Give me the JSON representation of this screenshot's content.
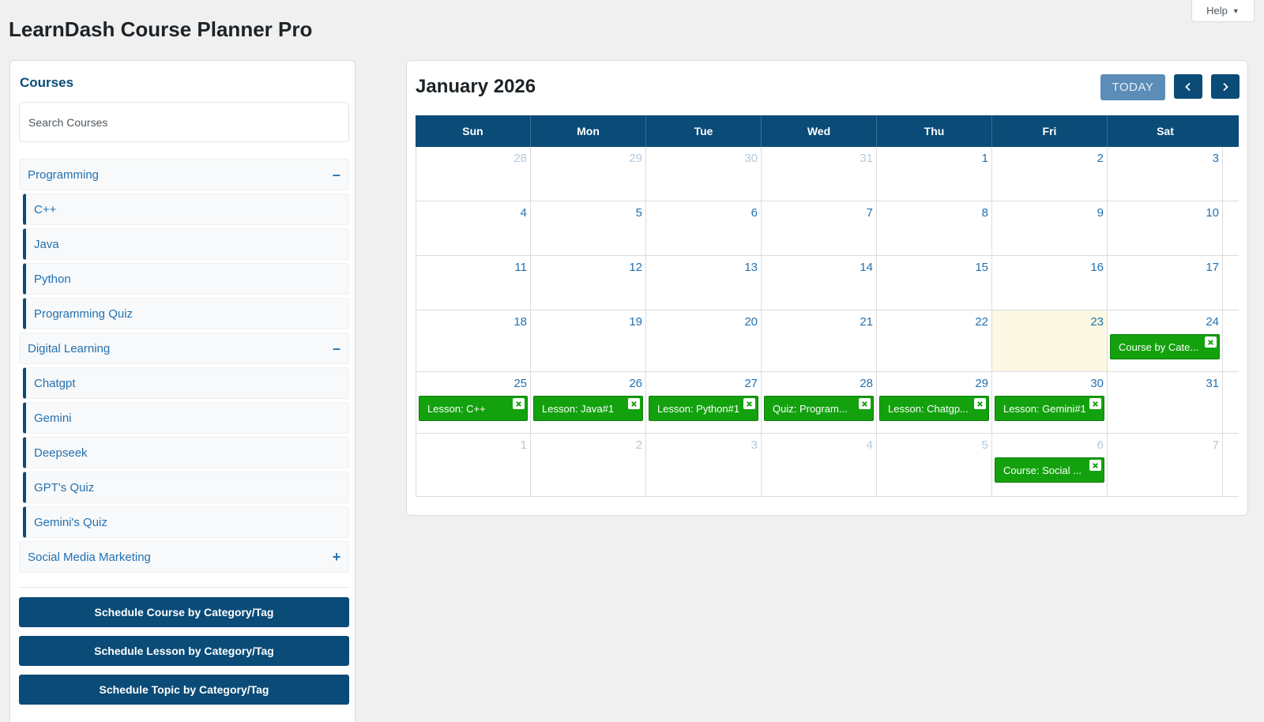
{
  "header": {
    "title": "LearnDash Course Planner Pro",
    "help_label": "Help"
  },
  "sidebar": {
    "title": "Courses",
    "search_placeholder": "Search Courses",
    "categories": [
      {
        "label": "Programming",
        "toggle": "–",
        "items": [
          "C++",
          "Java",
          "Python",
          "Programming Quiz"
        ]
      },
      {
        "label": "Digital Learning",
        "toggle": "–",
        "items": [
          "Chatgpt",
          "Gemini",
          "Deepseek",
          "GPT's Quiz",
          "Gemini's Quiz"
        ]
      },
      {
        "label": "Social Media Marketing",
        "toggle": "+",
        "items": []
      }
    ],
    "buttons": [
      "Schedule Course by Category/Tag",
      "Schedule Lesson by Category/Tag",
      "Schedule Topic by Category/Tag"
    ]
  },
  "calendar": {
    "title": "January 2026",
    "today_label": "TODAY",
    "days_of_week": [
      "Sun",
      "Mon",
      "Tue",
      "Wed",
      "Thu",
      "Fri",
      "Sat"
    ],
    "weeks": [
      [
        {
          "n": "28",
          "o": true
        },
        {
          "n": "29",
          "o": true
        },
        {
          "n": "30",
          "o": true
        },
        {
          "n": "31",
          "o": true
        },
        {
          "n": "1"
        },
        {
          "n": "2"
        },
        {
          "n": "3"
        }
      ],
      [
        {
          "n": "4"
        },
        {
          "n": "5"
        },
        {
          "n": "6"
        },
        {
          "n": "7"
        },
        {
          "n": "8"
        },
        {
          "n": "9"
        },
        {
          "n": "10"
        }
      ],
      [
        {
          "n": "11"
        },
        {
          "n": "12"
        },
        {
          "n": "13"
        },
        {
          "n": "14"
        },
        {
          "n": "15"
        },
        {
          "n": "16"
        },
        {
          "n": "17"
        }
      ],
      [
        {
          "n": "18"
        },
        {
          "n": "19"
        },
        {
          "n": "20"
        },
        {
          "n": "21"
        },
        {
          "n": "22"
        },
        {
          "n": "23",
          "today": true
        },
        {
          "n": "24",
          "event": "Course by Cate..."
        }
      ],
      [
        {
          "n": "25",
          "event": "Lesson: C++"
        },
        {
          "n": "26",
          "event": "Lesson: Java#1"
        },
        {
          "n": "27",
          "event": "Lesson: Python#1"
        },
        {
          "n": "28",
          "event": "Quiz: Program..."
        },
        {
          "n": "29",
          "event": "Lesson: Chatgp..."
        },
        {
          "n": "30",
          "event": "Lesson: Gemini#1"
        },
        {
          "n": "31"
        }
      ],
      [
        {
          "n": "1",
          "o": true
        },
        {
          "n": "2",
          "o": true
        },
        {
          "n": "3",
          "o": true
        },
        {
          "n": "4",
          "o": true
        },
        {
          "n": "5",
          "o": true
        },
        {
          "n": "6",
          "o": true,
          "event": "Course: Social ..."
        },
        {
          "n": "7",
          "o": true
        }
      ]
    ]
  },
  "colors": {
    "primary": "#0a4b78",
    "link": "#2271b1",
    "event_green": "#13a10e",
    "today_bg": "#fcf8e3",
    "today_button": "#5b8db8"
  },
  "icons": {
    "prev": "chevron-left-icon",
    "next": "chevron-right-icon",
    "event_remove": "close-icon",
    "help_caret": "caret-down-icon"
  }
}
